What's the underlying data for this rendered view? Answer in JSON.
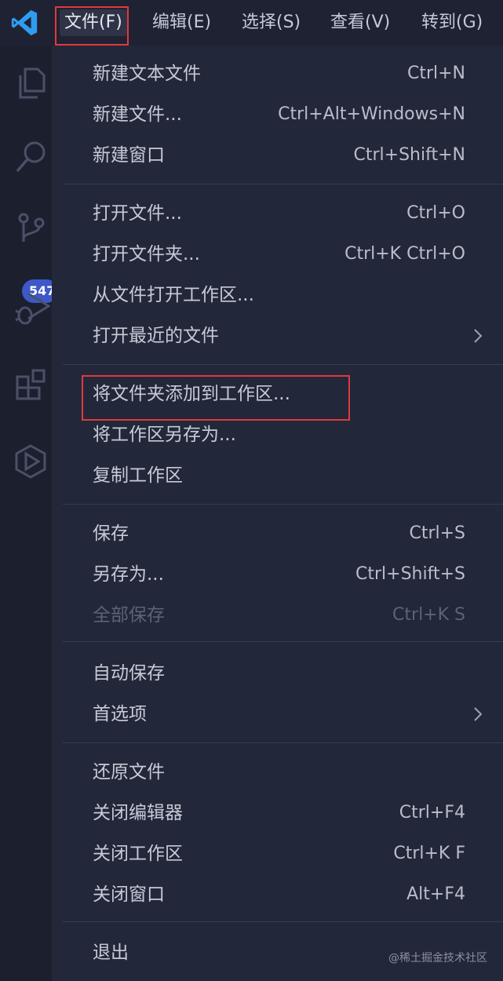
{
  "menubar": {
    "app_logo": "vscode-logo",
    "items": [
      {
        "label": "文件(F)",
        "active": true
      },
      {
        "label": "编辑(E)"
      },
      {
        "label": "选择(S)"
      },
      {
        "label": "查看(V)"
      },
      {
        "label": "转到(G)"
      }
    ]
  },
  "activity_bar": {
    "icons": [
      "files-icon",
      "search-icon",
      "source-control-icon",
      "run-debug-icon",
      "extensions-icon",
      "remote-explorer-icon"
    ],
    "scm_badge": "547"
  },
  "file_menu": {
    "groups": [
      [
        {
          "label": "新建文本文件",
          "shortcut": "Ctrl+N"
        },
        {
          "label": "新建文件...",
          "shortcut": "Ctrl+Alt+Windows+N"
        },
        {
          "label": "新建窗口",
          "shortcut": "Ctrl+Shift+N"
        }
      ],
      [
        {
          "label": "打开文件...",
          "shortcut": "Ctrl+O"
        },
        {
          "label": "打开文件夹...",
          "shortcut": "Ctrl+K Ctrl+O"
        },
        {
          "label": "从文件打开工作区...",
          "shortcut": ""
        },
        {
          "label": "打开最近的文件",
          "shortcut": "",
          "submenu": true
        }
      ],
      [
        {
          "label": "将文件夹添加到工作区...",
          "shortcut": "",
          "highlighted": true
        },
        {
          "label": "将工作区另存为...",
          "shortcut": ""
        },
        {
          "label": "复制工作区",
          "shortcut": ""
        }
      ],
      [
        {
          "label": "保存",
          "shortcut": "Ctrl+S"
        },
        {
          "label": "另存为...",
          "shortcut": "Ctrl+Shift+S"
        },
        {
          "label": "全部保存",
          "shortcut": "Ctrl+K S",
          "disabled": true
        }
      ],
      [
        {
          "label": "自动保存",
          "shortcut": ""
        },
        {
          "label": "首选项",
          "shortcut": "",
          "submenu": true
        }
      ],
      [
        {
          "label": "还原文件",
          "shortcut": ""
        },
        {
          "label": "关闭编辑器",
          "shortcut": "Ctrl+F4"
        },
        {
          "label": "关闭工作区",
          "shortcut": "Ctrl+K F"
        },
        {
          "label": "关闭窗口",
          "shortcut": "Alt+F4"
        }
      ],
      [
        {
          "label": "退出",
          "shortcut": ""
        }
      ]
    ]
  },
  "watermark": "@稀土掘金技术社区",
  "colors": {
    "menu_bg": "#23273a",
    "activity_bg": "#1c1f2e",
    "highlight_box": "#e0393b",
    "badge": "#3d58c7",
    "logo": "#2f9cf0"
  }
}
